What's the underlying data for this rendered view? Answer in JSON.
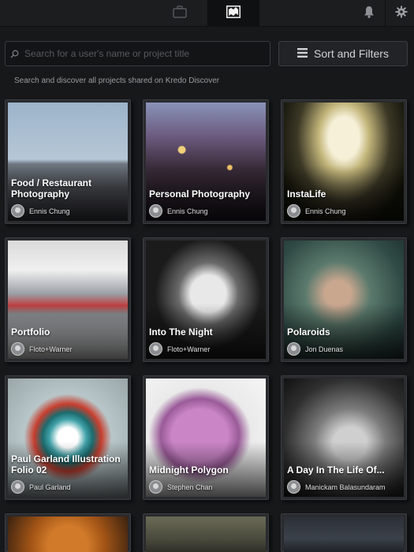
{
  "topbar": {
    "tabs": [
      {
        "name": "portfolio",
        "icon": "briefcase-icon"
      },
      {
        "name": "discover",
        "icon": "discover-icon",
        "active": true
      }
    ],
    "right_icons": [
      "bell-icon",
      "gear-icon"
    ]
  },
  "search": {
    "placeholder": "Search for a user's name or project title",
    "value": ""
  },
  "sort_button": {
    "label": "Sort and Filters",
    "icon": "list-icon"
  },
  "hint": "Search and discover all projects shared on Kredo Discover",
  "projects": [
    {
      "title": "Food / Restaurant Photography",
      "author": "Ennis Chung"
    },
    {
      "title": "Personal Photography",
      "author": "Ennis Chung"
    },
    {
      "title": "InstaLife",
      "author": "Ennis Chung"
    },
    {
      "title": "Portfolio",
      "author": "Floto+Warner"
    },
    {
      "title": "Into The Night",
      "author": "Floto+Warner"
    },
    {
      "title": "Polaroids",
      "author": "Jon Duenas"
    },
    {
      "title": "Paul Garland Illustration Folio 02",
      "author": "Paul Garland"
    },
    {
      "title": "Midnight Polygon",
      "author": "Stephen Chan"
    },
    {
      "title": "A Day In The Life Of...",
      "author": "Manickam Balasundaram"
    },
    {
      "title": "",
      "author": ""
    },
    {
      "title": "",
      "author": ""
    },
    {
      "title": "",
      "author": ""
    }
  ]
}
